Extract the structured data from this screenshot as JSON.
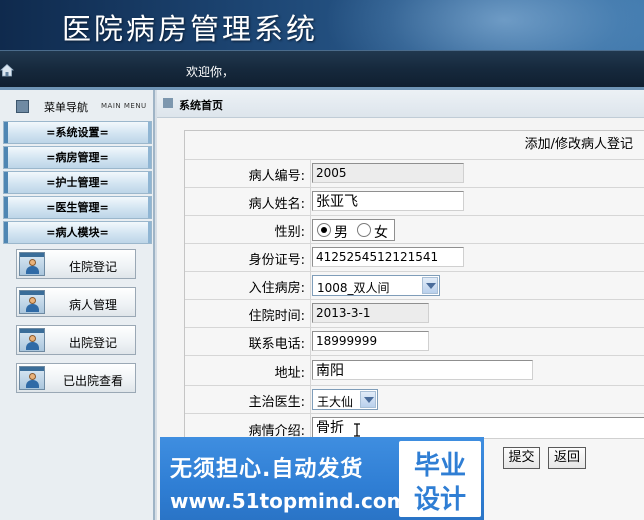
{
  "app": {
    "title": "医院病房管理系统",
    "welcome": "欢迎你，"
  },
  "sidebar": {
    "header": {
      "label": "菜单导航",
      "sub": "MAIN MENU"
    },
    "categories": [
      "=系统设置=",
      "=病房管理=",
      "=护士管理=",
      "=医生管理=",
      "=病人模块="
    ],
    "items": [
      "住院登记",
      "病人管理",
      "出院登记",
      "已出院查看"
    ]
  },
  "breadcrumb": "系统首页",
  "form": {
    "title": "添加/修改病人登记",
    "fields": {
      "id": {
        "label": "病人编号:",
        "value": "2005"
      },
      "name": {
        "label": "病人姓名:",
        "value": "张亚飞"
      },
      "gender": {
        "label": "性别:",
        "options": [
          "男",
          "女"
        ],
        "selected": "男"
      },
      "idcard": {
        "label": "身份证号:",
        "value": "4125254512121541"
      },
      "room": {
        "label": "入住病房:",
        "value": "1008_双人间"
      },
      "admit_time": {
        "label": "住院时间:",
        "value": "2013-3-1"
      },
      "phone": {
        "label": "联系电话:",
        "value": "18999999"
      },
      "address": {
        "label": "地址:",
        "value": "南阳"
      },
      "doctor": {
        "label": "主治医生:",
        "value": "王大仙"
      },
      "illness": {
        "label": "病情介绍:",
        "value": "骨折"
      }
    },
    "buttons": {
      "submit": "提交",
      "back": "返回"
    }
  },
  "watermark": {
    "line1": "无须担心.自动发货",
    "line2": "www.51topmind.com",
    "badge1": "毕业",
    "badge2": "设计"
  },
  "colors": {
    "accent": "#2f7ed4",
    "banner": "#1d4674",
    "strip": "#16293d"
  }
}
